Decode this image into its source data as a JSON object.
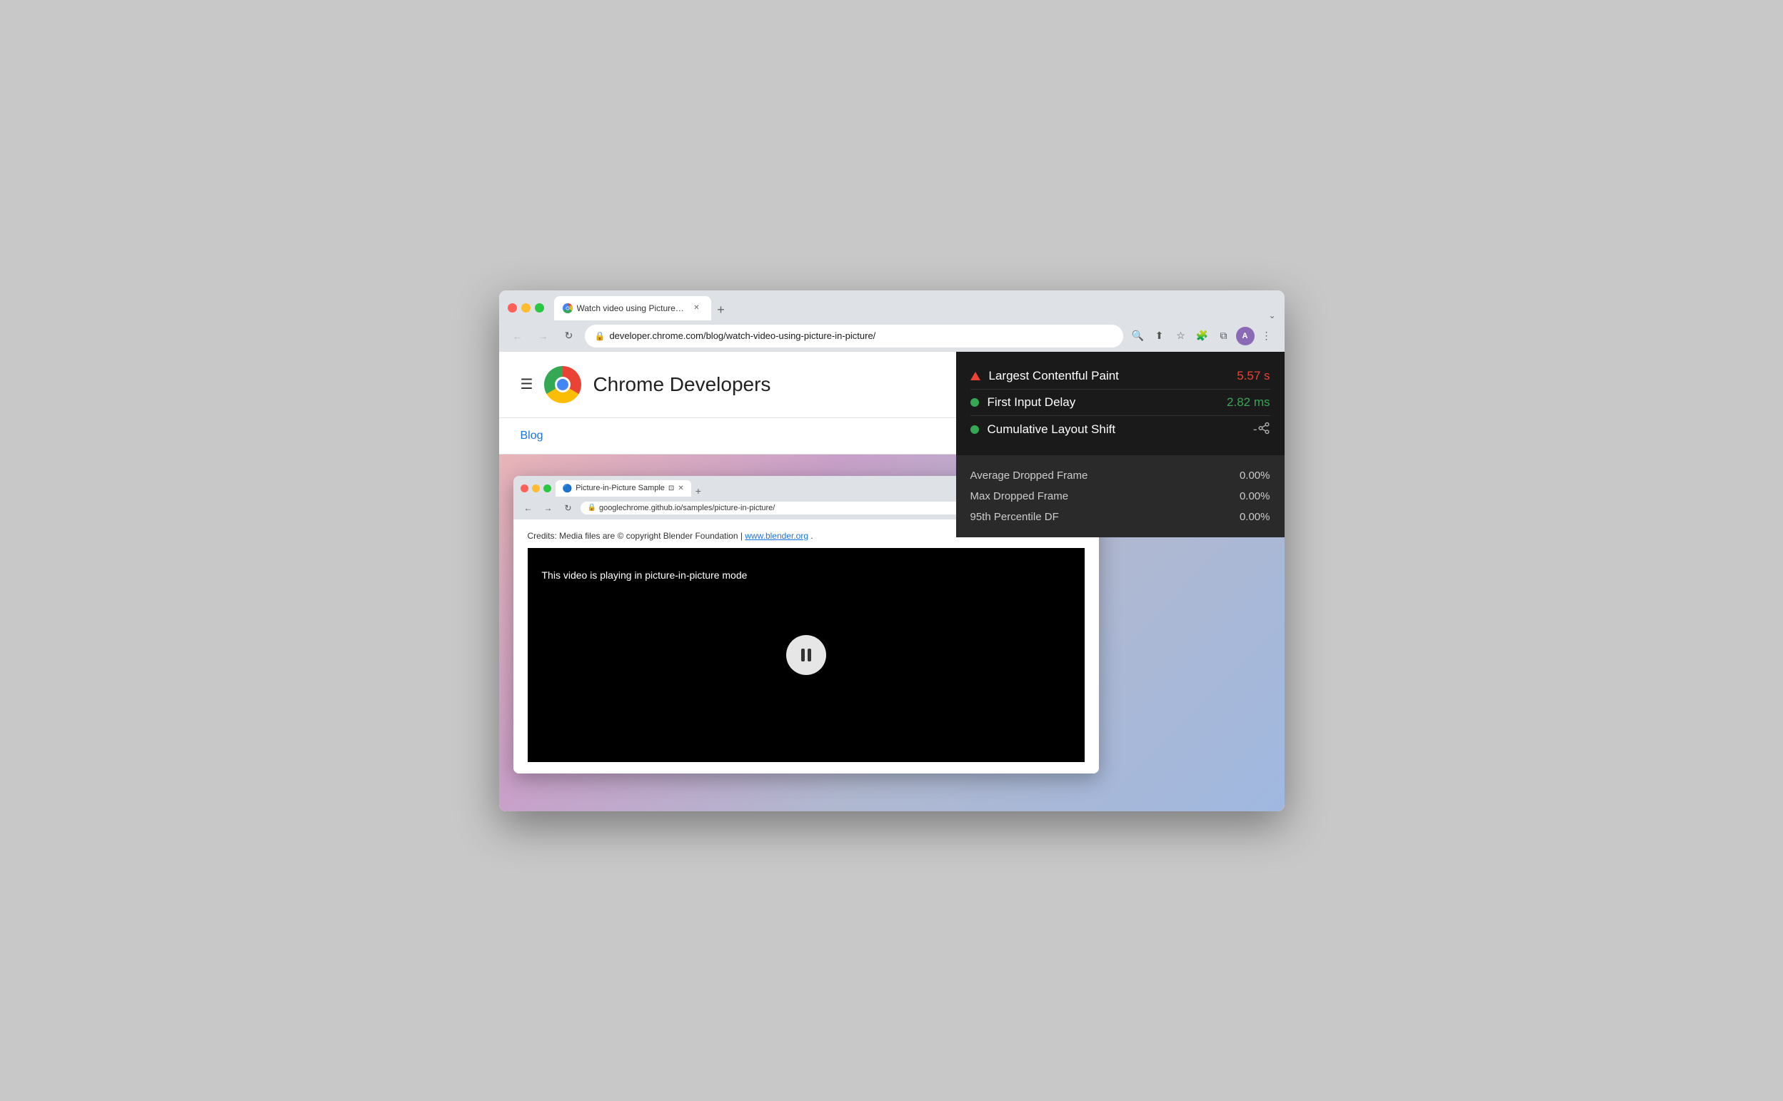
{
  "browser": {
    "tab": {
      "title": "Watch video using Picture-in-P",
      "favicon": "chrome-favicon"
    },
    "url": "developer.chrome.com/blog/watch-video-using-picture-in-picture/",
    "nav": {
      "back": "←",
      "forward": "→",
      "refresh": "↻",
      "search_icon": "🔍",
      "share_icon": "⬆",
      "bookmark_icon": "☆",
      "extensions_icon": "🧩",
      "window_icon": "⧉",
      "menu_icon": "⋮"
    }
  },
  "chrome_dev_page": {
    "title": "Chrome Developers",
    "breadcrumb": "Blog"
  },
  "inner_browser": {
    "tab": {
      "title": "Picture-in-Picture Sample"
    },
    "url": "googlechrome.github.io/samples/picture-in-picture/",
    "credits_text": "Credits: Media files are © copyright Blender Foundation |",
    "credits_link": "www.blender.org",
    "credits_end": ".",
    "video_subtitle": "This video is playing in picture-in-picture mode"
  },
  "perf_panel": {
    "metrics": [
      {
        "name": "Largest Contentful Paint",
        "value": "5.57 s",
        "color": "red",
        "indicator": "triangle"
      },
      {
        "name": "First Input Delay",
        "value": "2.82 ms",
        "color": "green",
        "indicator": "dot"
      },
      {
        "name": "Cumulative Layout Shift",
        "value": "-",
        "color": "green",
        "indicator": "dot"
      }
    ],
    "stats": [
      {
        "label": "Average Dropped Frame",
        "value": "0.00%"
      },
      {
        "label": "Max Dropped Frame",
        "value": "0.00%"
      },
      {
        "label": "95th Percentile DF",
        "value": "0.00%"
      }
    ]
  }
}
